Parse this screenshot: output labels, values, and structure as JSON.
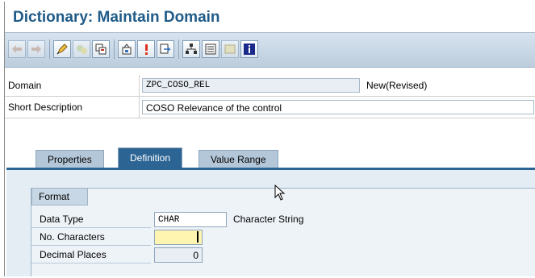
{
  "window": {
    "title": "Dictionary: Maintain Domain"
  },
  "toolbar": {
    "buttons": [
      {
        "name": "back-icon"
      },
      {
        "name": "forward-icon"
      },
      {
        "name": "display-change-icon"
      },
      {
        "name": "activate-icon"
      },
      {
        "name": "copy-object-icon"
      },
      {
        "name": "where-used-icon"
      },
      {
        "name": "check-icon"
      },
      {
        "name": "navigate-icon"
      },
      {
        "name": "hierarchy-icon"
      },
      {
        "name": "object-list-icon"
      },
      {
        "name": "blank-icon"
      },
      {
        "name": "info-icon"
      }
    ]
  },
  "header": {
    "domain_label": "Domain",
    "domain_value": "ZPC_COSO_REL",
    "domain_status": "New(Revised)",
    "desc_label": "Short Description",
    "desc_value": "COSO Relevance of the control"
  },
  "tabs": [
    {
      "label": "Properties"
    },
    {
      "label": "Definition"
    },
    {
      "label": "Value Range"
    }
  ],
  "format": {
    "group_title": "Format",
    "data_type_label": "Data Type",
    "data_type_value": "CHAR",
    "data_type_desc": "Character String",
    "num_chars_label": "No. Characters",
    "num_chars_value": "",
    "decimal_label": "Decimal Places",
    "decimal_value": "0"
  }
}
